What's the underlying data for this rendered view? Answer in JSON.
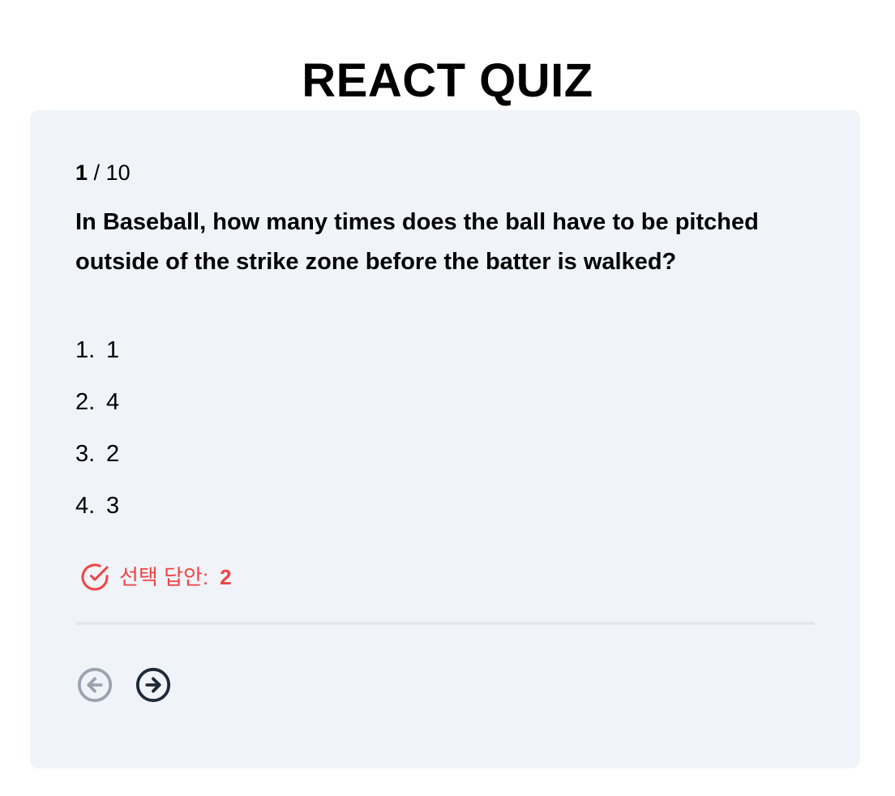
{
  "header": {
    "title": "REACT QUIZ"
  },
  "quiz": {
    "progress": {
      "current": "1",
      "separator": " / ",
      "total": "10"
    },
    "question": "In Baseball, how many times does the ball have to be pitched outside of the strike zone before the batter is walked?",
    "options": [
      {
        "number": "1.",
        "text": "1"
      },
      {
        "number": "2.",
        "text": "4"
      },
      {
        "number": "3.",
        "text": "2"
      },
      {
        "number": "4.",
        "text": "3"
      }
    ],
    "selected_answer": {
      "icon": "check-circle-icon",
      "label": "선택 답안:",
      "value": "2"
    }
  },
  "navigation": {
    "prev_icon": "arrow-left-circle-icon",
    "next_icon": "arrow-right-circle-icon",
    "prev_enabled": false
  },
  "colors": {
    "card_background": "#f0f3f8",
    "accent_red": "#ef4444",
    "nav_active": "#1f2937",
    "nav_disabled": "#9ca3af",
    "divider": "#e3e6eb"
  }
}
